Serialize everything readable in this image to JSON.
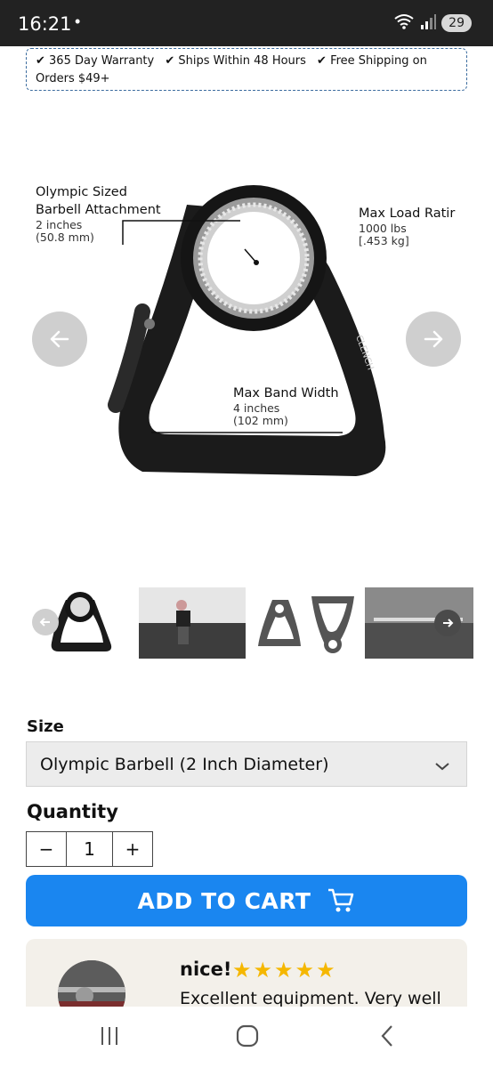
{
  "status_bar": {
    "time": "16:21",
    "dot": "•",
    "battery": "29",
    "icons": [
      "wifi-icon",
      "signal-icon",
      "battery-icon"
    ]
  },
  "banner": {
    "items": [
      "✔ 365 Day Warranty",
      "✔ Ships Within 48 Hours",
      "✔ Free Shipping on Orders $49+"
    ]
  },
  "product_image": {
    "label_attachment_title_1": "Olympic Sized",
    "label_attachment_title_2": "Barbell Attachment",
    "label_attachment_sub_1": "2 inches",
    "label_attachment_sub_2": "(50.8 mm)",
    "label_load_title": "Max Load Ratir",
    "label_load_sub_1": "1000 lbs",
    "label_load_sub_2": "[.453 kg]",
    "label_band_title": "Max Band Width",
    "label_band_sub_1": "4 inches",
    "label_band_sub_2": "(102 mm)",
    "brand": "CLENCH"
  },
  "size": {
    "label": "Size",
    "selected": "Olympic Barbell (2 Inch Diameter)"
  },
  "quantity": {
    "label": "Quantity",
    "minus": "−",
    "value": "1",
    "plus": "+"
  },
  "add_to_cart": {
    "label": "ADD TO CART"
  },
  "review": {
    "title": "nice!",
    "stars": "★★★★★",
    "text": "Excellent equipment. Very well",
    "rating": 5
  },
  "colors": {
    "accent": "#1a86f0",
    "star": "#f5b700",
    "status_bar": "#222222"
  }
}
